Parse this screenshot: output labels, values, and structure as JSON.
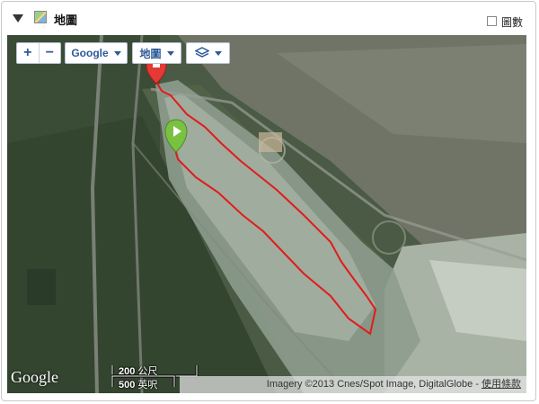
{
  "header": {
    "title": "地圖",
    "checkbox_label": "圖數"
  },
  "map_controls": {
    "zoom_in": "+",
    "zoom_out": "−",
    "provider": "Google",
    "map_type": "地圖"
  },
  "scale": {
    "metric_value": "200",
    "metric_unit": "公尺",
    "imperial_value": "500",
    "imperial_unit": "英呎"
  },
  "attribution": {
    "text": "Imagery ©2013 Cnes/Spot Image, DigitalGlobe - ",
    "terms_link": "使用條款"
  },
  "logo": "Google",
  "colors": {
    "route": "#e21b1b",
    "start_marker": "#7ac142",
    "end_marker": "#e53935",
    "control_text": "#2d5a9a"
  },
  "icons": {
    "collapse": "triangle-down-icon",
    "map": "map-icon",
    "layers": "layers-icon"
  }
}
